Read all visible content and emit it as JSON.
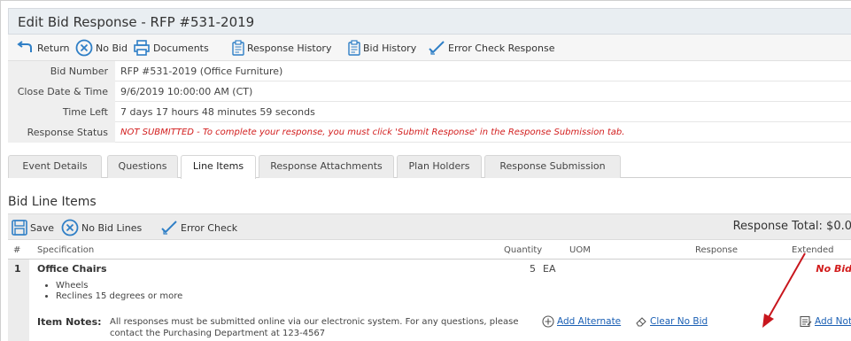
{
  "page": {
    "title": "Edit Bid Response - RFP #531-2019"
  },
  "toolbar": {
    "return_label": "Return",
    "no_bid_label": "No Bid",
    "documents_label": "Documents",
    "response_history_label": "Response History",
    "bid_history_label": "Bid History",
    "error_check_label": "Error Check Response"
  },
  "info": {
    "bid_number": {
      "label": "Bid Number",
      "value": "RFP #531-2019 (Office Furniture)"
    },
    "close_date": {
      "label": "Close Date & Time",
      "value": "9/6/2019 10:00:00 AM (CT)"
    },
    "time_left": {
      "label": "Time Left",
      "value": "7 days 17 hours 48 minutes 59 seconds"
    },
    "response_status": {
      "label": "Response Status",
      "value": "NOT SUBMITTED - To complete your response, you must click 'Submit Response' in the Response Submission tab."
    }
  },
  "tabs": [
    {
      "label": "Event Details"
    },
    {
      "label": "Questions"
    },
    {
      "label": "Line Items",
      "active": true
    },
    {
      "label": "Response Attachments"
    },
    {
      "label": "Plan Holders"
    },
    {
      "label": "Response Submission"
    }
  ],
  "lines": {
    "section_title": "Bid Line Items",
    "save_label": "Save",
    "no_bid_lines_label": "No Bid Lines",
    "error_check_label": "Error Check",
    "total_label": "Response Total: $0.0"
  },
  "table": {
    "headers": {
      "num": "#",
      "spec": "Specification",
      "quantity": "Quantity",
      "uom": "UOM",
      "response": "Response",
      "extended": "Extended"
    },
    "rows": [
      {
        "num": "1",
        "spec": "Office Chairs",
        "quantity": "5",
        "uom": "EA",
        "extended": "No Bid",
        "bullets": [
          "Wheels",
          "Reclines 15 degrees or more"
        ],
        "notes_label": "Item Notes:",
        "notes": "All responses must be submitted online via our electronic system. For any questions, please contact the Purchasing Department at 123-4567",
        "actions": {
          "add_alternate": "Add Alternate",
          "clear_no_bid": "Clear No Bid",
          "add_notes": "Add Note"
        }
      }
    ]
  },
  "colors": {
    "accent": "#1a5fb4",
    "alert": "#d21d1d",
    "annotation_arrow": "#c8161d"
  }
}
